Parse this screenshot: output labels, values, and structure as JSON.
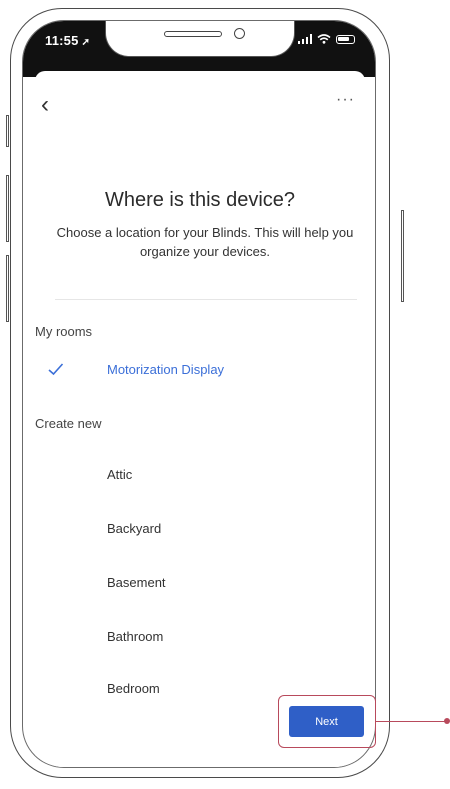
{
  "status_bar": {
    "time": "11:55",
    "location_glyph": "➚"
  },
  "header": {
    "back_icon": "chevron-left-icon",
    "more_icon": "more-horizontal-icon"
  },
  "main": {
    "title": "Where is this device?",
    "subtitle": "Choose a location for your Blinds. This will help you organize your devices."
  },
  "my_rooms": {
    "label": "My rooms",
    "items": [
      {
        "label": "Motorization Display",
        "selected": true
      }
    ]
  },
  "create_new": {
    "label": "Create new",
    "items": [
      {
        "label": "Attic"
      },
      {
        "label": "Backyard"
      },
      {
        "label": "Basement"
      },
      {
        "label": "Bathroom"
      },
      {
        "label": "Bedroom"
      }
    ]
  },
  "footer": {
    "next_label": "Next"
  },
  "colors": {
    "accent": "#3b6fd8",
    "button": "#2f5fc7",
    "callout": "#b84a5c"
  }
}
